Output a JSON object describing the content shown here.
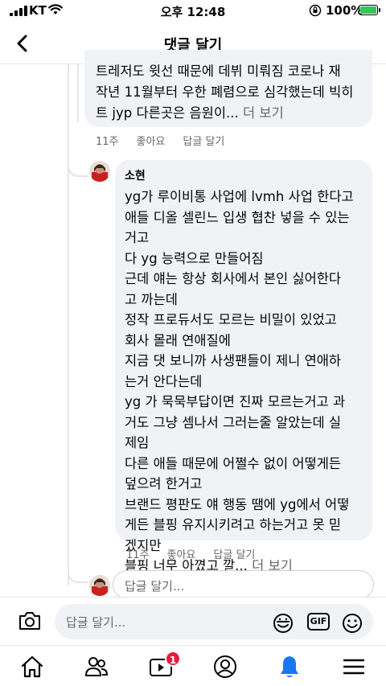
{
  "status_bar": {
    "carrier": "KT",
    "time": "오후 12:48",
    "battery": "100%",
    "battery_fill": 1.0
  },
  "header": {
    "title": "댓글 달기",
    "back_icon": "chevron-left-icon"
  },
  "comments": [
    {
      "author": "",
      "lines": [
        "트레저도 윗선 때문에 데뷔 미뤄짐 코로나 재",
        "작년 11월부터 우한 폐렴으로 심각했는데 빅히",
        "트 jyp 다른곳은 음원이..."
      ],
      "more": "더 보기",
      "age": "11주",
      "like": "좋아요",
      "reply": "답글 달기"
    },
    {
      "author": "소현",
      "lines": [
        "yg가 루이비통 사업에 lvmh 사업 한다고",
        "애들 디올 셀린느 입생 협찬 넣을 수 있는",
        "거고",
        "다 yg 능력으로 만들어짐",
        "근데 얘는 항상 회사에서 본인 싫어한다",
        "고 까는데",
        "정작 프로듀서도 모르는 비밀이 있었고",
        "회사 몰래 연애질에",
        "지금 댓 보니까 사생팬들이 제니 연애하",
        "는거 안다는데",
        "yg 가 묵묵부답이면 진짜 모르는거고 과",
        "거도 그냥 셈나서 그러는줄 알았는데 실",
        "제임",
        "다른 애들 때문에 어쩔수 없이 어떻게든",
        "덮으려 한거고",
        "브랜드 평판도 얘 행동 땜에 yg에서 어떻",
        "게든 블핑 유지시키려고 하는거고 못 믿",
        "겠지만",
        "블핑 너무 아꼈고 깔..."
      ],
      "more": "더 보기",
      "age": "11주",
      "like": "좋아요",
      "reply": "답글 달기"
    }
  ],
  "reply_box": {
    "placeholder": "답글 달기..."
  },
  "composer": {
    "placeholder": "답글 달기...",
    "camera_icon": "camera-icon",
    "sticker_icon": "sticker-icon",
    "gif_label": "GIF",
    "emoji_icon": "emoji-icon"
  },
  "tabbar": {
    "tabs": [
      "home-icon",
      "friends-icon",
      "watch-icon",
      "profile-icon",
      "notifications-icon",
      "menu-icon"
    ],
    "watch_badge": "1",
    "active_tab": "notifications-icon",
    "accent_color": "#1877f2"
  }
}
